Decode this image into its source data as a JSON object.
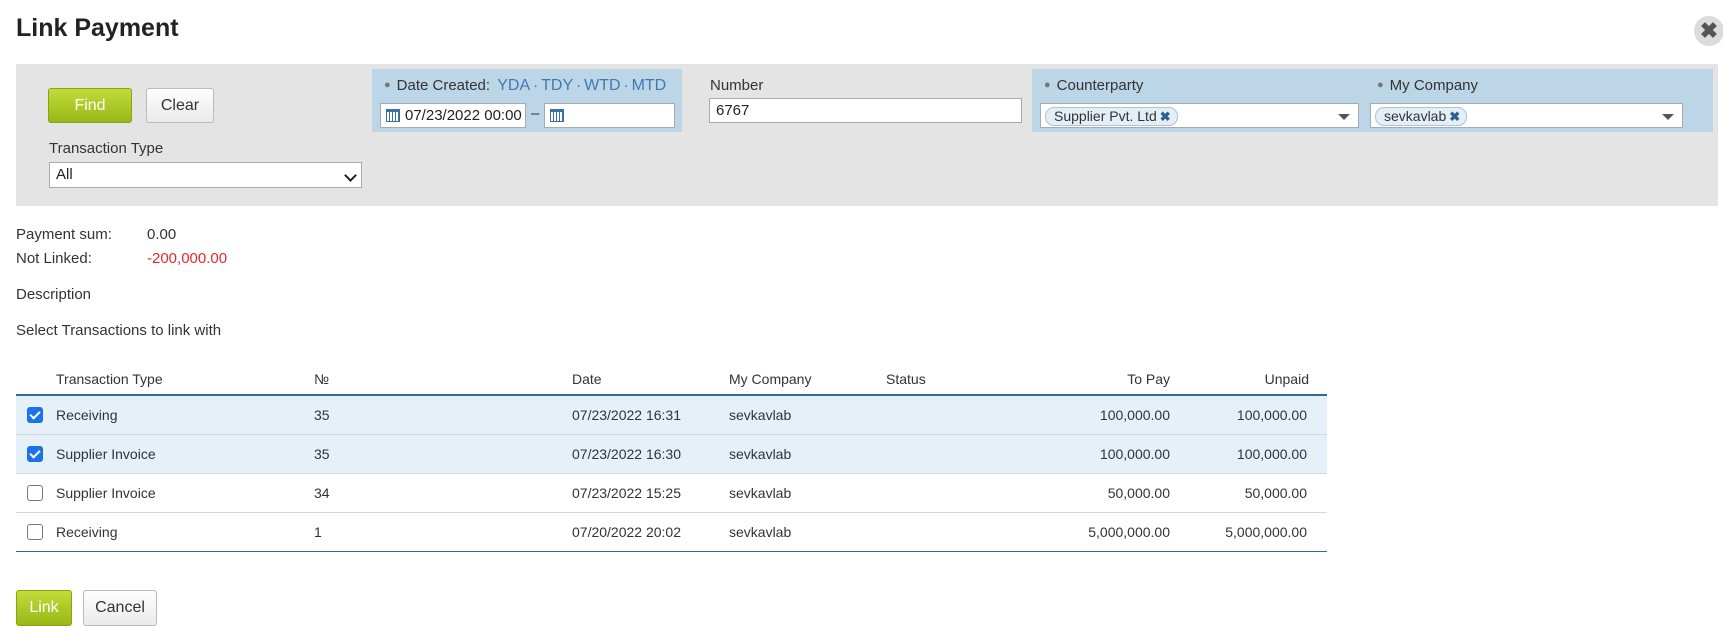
{
  "dialog": {
    "title": "Link Payment",
    "close_label": "✖"
  },
  "filters": {
    "find_label": "Find",
    "clear_label": "Clear",
    "transaction_type": {
      "label": "Transaction Type",
      "value": "All"
    },
    "date_created": {
      "label": "Date Created:",
      "quick": [
        "YDA",
        "TDY",
        "WTD",
        "MTD"
      ],
      "from": "07/23/2022 00:00",
      "separator": "–",
      "to": ""
    },
    "number": {
      "label": "Number",
      "value": "6767"
    },
    "counterparty": {
      "label": "Counterparty",
      "tag": "Supplier Pvt. Ltd"
    },
    "my_company": {
      "label": "My Company",
      "tag": "sevkavlab"
    }
  },
  "summary": {
    "payment_sum_label": "Payment sum:",
    "payment_sum_value": "0.00",
    "not_linked_label": "Not Linked:",
    "not_linked_value": "-200,000.00",
    "description_label": "Description",
    "select_label": "Select Transactions to link with"
  },
  "table": {
    "headers": {
      "type": "Transaction Type",
      "number": "№",
      "date": "Date",
      "company": "My Company",
      "status": "Status",
      "to_pay": "To Pay",
      "unpaid": "Unpaid"
    },
    "rows": [
      {
        "checked": true,
        "type": "Receiving",
        "number": "35",
        "date": "07/23/2022 16:31",
        "company": "sevkavlab",
        "status": "",
        "to_pay": "100,000.00",
        "unpaid": "100,000.00"
      },
      {
        "checked": true,
        "type": "Supplier Invoice",
        "number": "35",
        "date": "07/23/2022 16:30",
        "company": "sevkavlab",
        "status": "",
        "to_pay": "100,000.00",
        "unpaid": "100,000.00"
      },
      {
        "checked": false,
        "type": "Supplier Invoice",
        "number": "34",
        "date": "07/23/2022 15:25",
        "company": "sevkavlab",
        "status": "",
        "to_pay": "50,000.00",
        "unpaid": "50,000.00"
      },
      {
        "checked": false,
        "type": "Receiving",
        "number": "1",
        "date": "07/20/2022 20:02",
        "company": "sevkavlab",
        "status": "",
        "to_pay": "5,000,000.00",
        "unpaid": "5,000,000.00"
      }
    ]
  },
  "actions": {
    "link_label": "Link",
    "cancel_label": "Cancel"
  },
  "colors": {
    "accent_green": "#98b818",
    "filter_blue": "#bcd6e8",
    "negative": "#e0292a",
    "link": "#3d7ab3"
  }
}
